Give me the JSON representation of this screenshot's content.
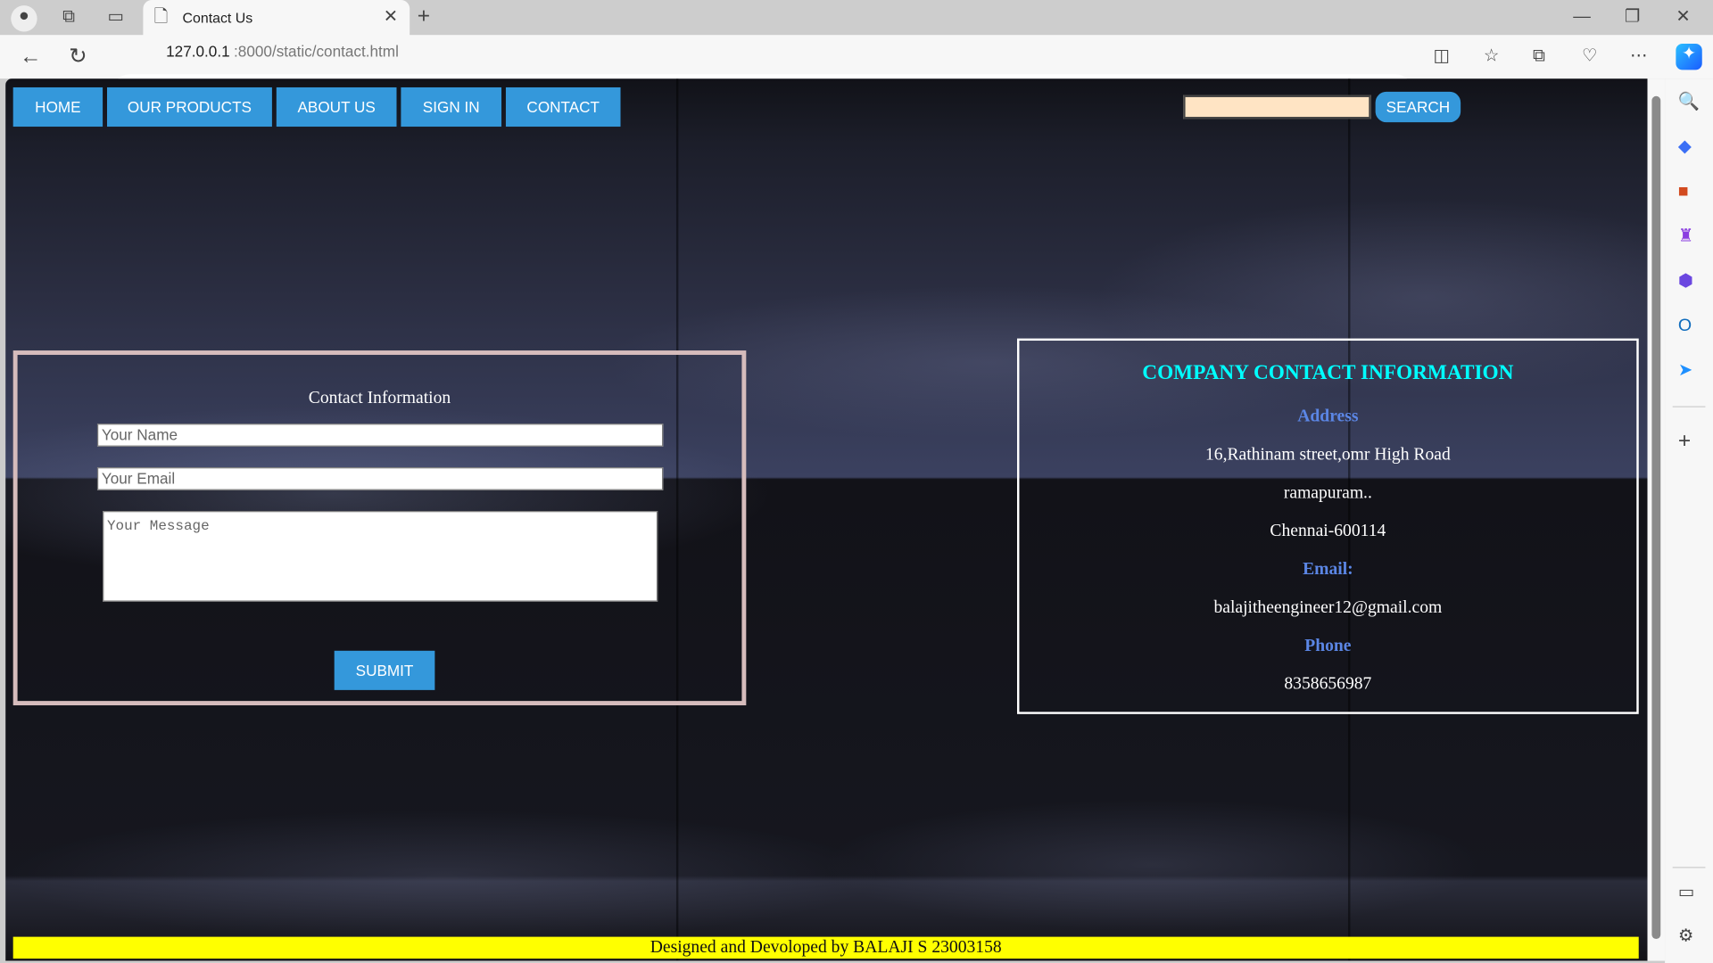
{
  "browser": {
    "tab_title": "Contact Us",
    "url_host": "127.0.0.1",
    "url_rest": ":8000/static/contact.html"
  },
  "nav": [
    {
      "label": "HOME"
    },
    {
      "label": "OUR PRODUCTS"
    },
    {
      "label": "ABOUT US"
    },
    {
      "label": "SIGN IN"
    },
    {
      "label": "CONTACT"
    }
  ],
  "search": {
    "value": "",
    "button": "SEARCH"
  },
  "form": {
    "title": "Contact Information",
    "name_placeholder": "Your Name",
    "email_placeholder": "Your Email",
    "message_placeholder": "Your Message",
    "submit": "SUBMIT"
  },
  "company": {
    "title": "COMPANY CONTACT INFORMATION",
    "address_label": "Address",
    "address_lines": [
      "16,Rathinam street,omr High Road",
      "ramapuram..",
      "Chennai-600114"
    ],
    "email_label": "Email:",
    "email": "balajitheengineer12@gmail.com",
    "phone_label": "Phone",
    "phone": "8358656987"
  },
  "footer": "Designed and Devoloped by BALAJI S 23003158",
  "colors": {
    "accent": "#3498db",
    "heading": "#00ffff",
    "label": "#5b86e5",
    "footer": "#ffff00"
  }
}
